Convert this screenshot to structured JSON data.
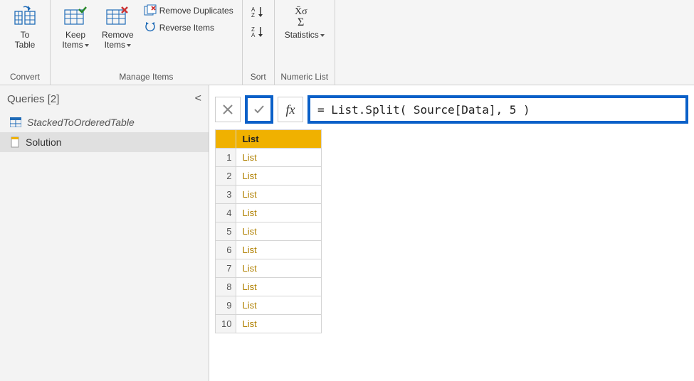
{
  "ribbon": {
    "groups": {
      "convert": {
        "label": "Convert",
        "to_table": "To\nTable"
      },
      "manage": {
        "label": "Manage Items",
        "keep_items": "Keep\nItems",
        "remove_items": "Remove\nItems",
        "remove_dup": "Remove Duplicates",
        "reverse": "Reverse Items"
      },
      "sort": {
        "label": "Sort"
      },
      "numeric": {
        "label": "Numeric List",
        "statistics": "Statistics"
      }
    }
  },
  "queries": {
    "header": "Queries [2]",
    "items": [
      {
        "name": "StackedToOrderedTable",
        "italic": true
      },
      {
        "name": "Solution",
        "italic": false,
        "selected": true
      }
    ]
  },
  "formula_bar": {
    "formula": "= List.Split( Source[Data], 5 )"
  },
  "result_table": {
    "header": "List",
    "rows": [
      {
        "n": "1",
        "v": "List"
      },
      {
        "n": "2",
        "v": "List"
      },
      {
        "n": "3",
        "v": "List"
      },
      {
        "n": "4",
        "v": "List"
      },
      {
        "n": "5",
        "v": "List"
      },
      {
        "n": "6",
        "v": "List"
      },
      {
        "n": "7",
        "v": "List"
      },
      {
        "n": "8",
        "v": "List"
      },
      {
        "n": "9",
        "v": "List"
      },
      {
        "n": "10",
        "v": "List"
      }
    ]
  }
}
